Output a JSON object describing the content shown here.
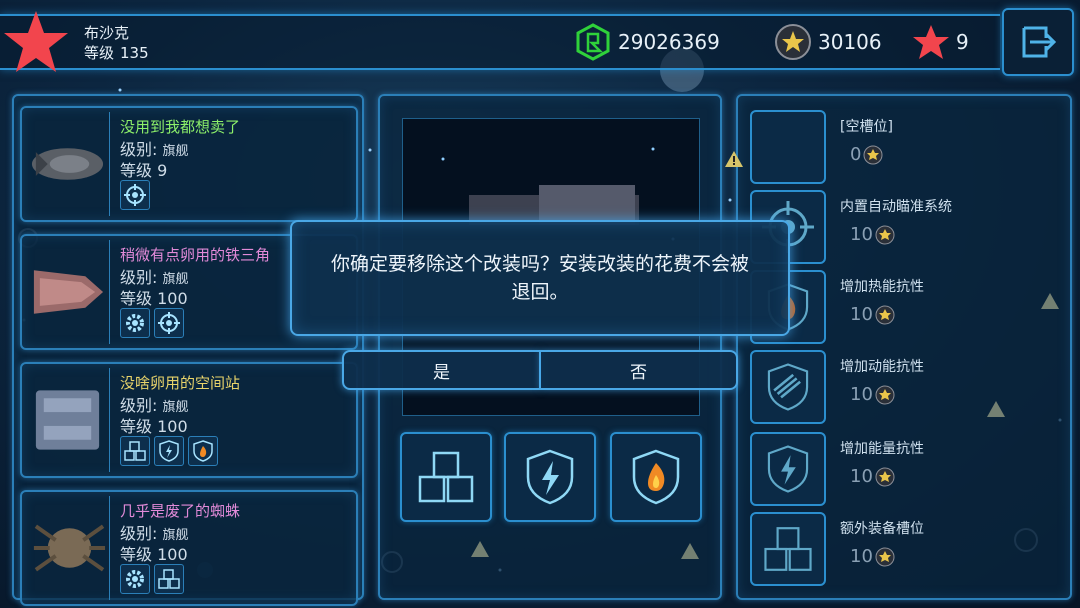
{
  "player": {
    "name": "布沙克",
    "level_label": "等级",
    "level_value": "135"
  },
  "resources": [
    {
      "icon": "green-crystal-icon",
      "value": "29026369"
    },
    {
      "icon": "gold-star-coin-icon",
      "value": "30106"
    },
    {
      "icon": "red-star-icon",
      "value": "9"
    }
  ],
  "ships": [
    {
      "name": "没用到我都想卖了",
      "name_color": "#8df06a",
      "class_label": "级别:",
      "class_value": "旗舰",
      "level_label": "等级",
      "level_value": "9",
      "mods": [
        "crosshair-icon"
      ]
    },
    {
      "name": "稍微有点卵用的铁三角",
      "name_color": "#e18ad8",
      "class_label": "级别:",
      "class_value": "旗舰",
      "level_label": "等级",
      "level_value": "100",
      "mods": [
        "gear-icon",
        "crosshair-icon"
      ]
    },
    {
      "name": "没啥卵用的空间站",
      "name_color": "#e7d36a",
      "class_label": "级别:",
      "class_value": "旗舰",
      "level_label": "等级",
      "level_value": "100",
      "mods": [
        "cubes-icon",
        "lightning-shield-icon",
        "fire-shield-icon"
      ]
    },
    {
      "name": "几乎是废了的蜘蛛",
      "name_color": "#e18ad8",
      "class_label": "级别:",
      "class_value": "旗舰",
      "level_label": "等级",
      "level_value": "100",
      "mods": [
        "gear-icon",
        "cubes-icon"
      ]
    }
  ],
  "upgrades": [
    {
      "name": "[空槽位]",
      "cost": "0",
      "icon": "empty-slot-icon"
    },
    {
      "name": "内置自动瞄准系统",
      "cost": "10",
      "icon": "crosshair-icon"
    },
    {
      "name": "增加热能抗性",
      "cost": "10",
      "icon": "fire-shield-icon"
    },
    {
      "name": "增加动能抗性",
      "cost": "10",
      "icon": "kinetic-shield-icon"
    },
    {
      "name": "增加能量抗性",
      "cost": "10",
      "icon": "lightning-shield-icon"
    },
    {
      "name": "额外装备槽位",
      "cost": "10",
      "icon": "cubes-icon"
    }
  ],
  "slots": [
    "cubes-icon",
    "lightning-shield-icon",
    "fire-shield-icon"
  ],
  "dialog": {
    "message": "你确定要移除这个改装吗？安装改装的花费不会被退回。",
    "yes": "是",
    "no": "否"
  },
  "colors": {
    "accent": "#2b8fcf",
    "star_red": "#f2454d",
    "crystal_green": "#2fd13a",
    "gold": "#e9c54a"
  }
}
